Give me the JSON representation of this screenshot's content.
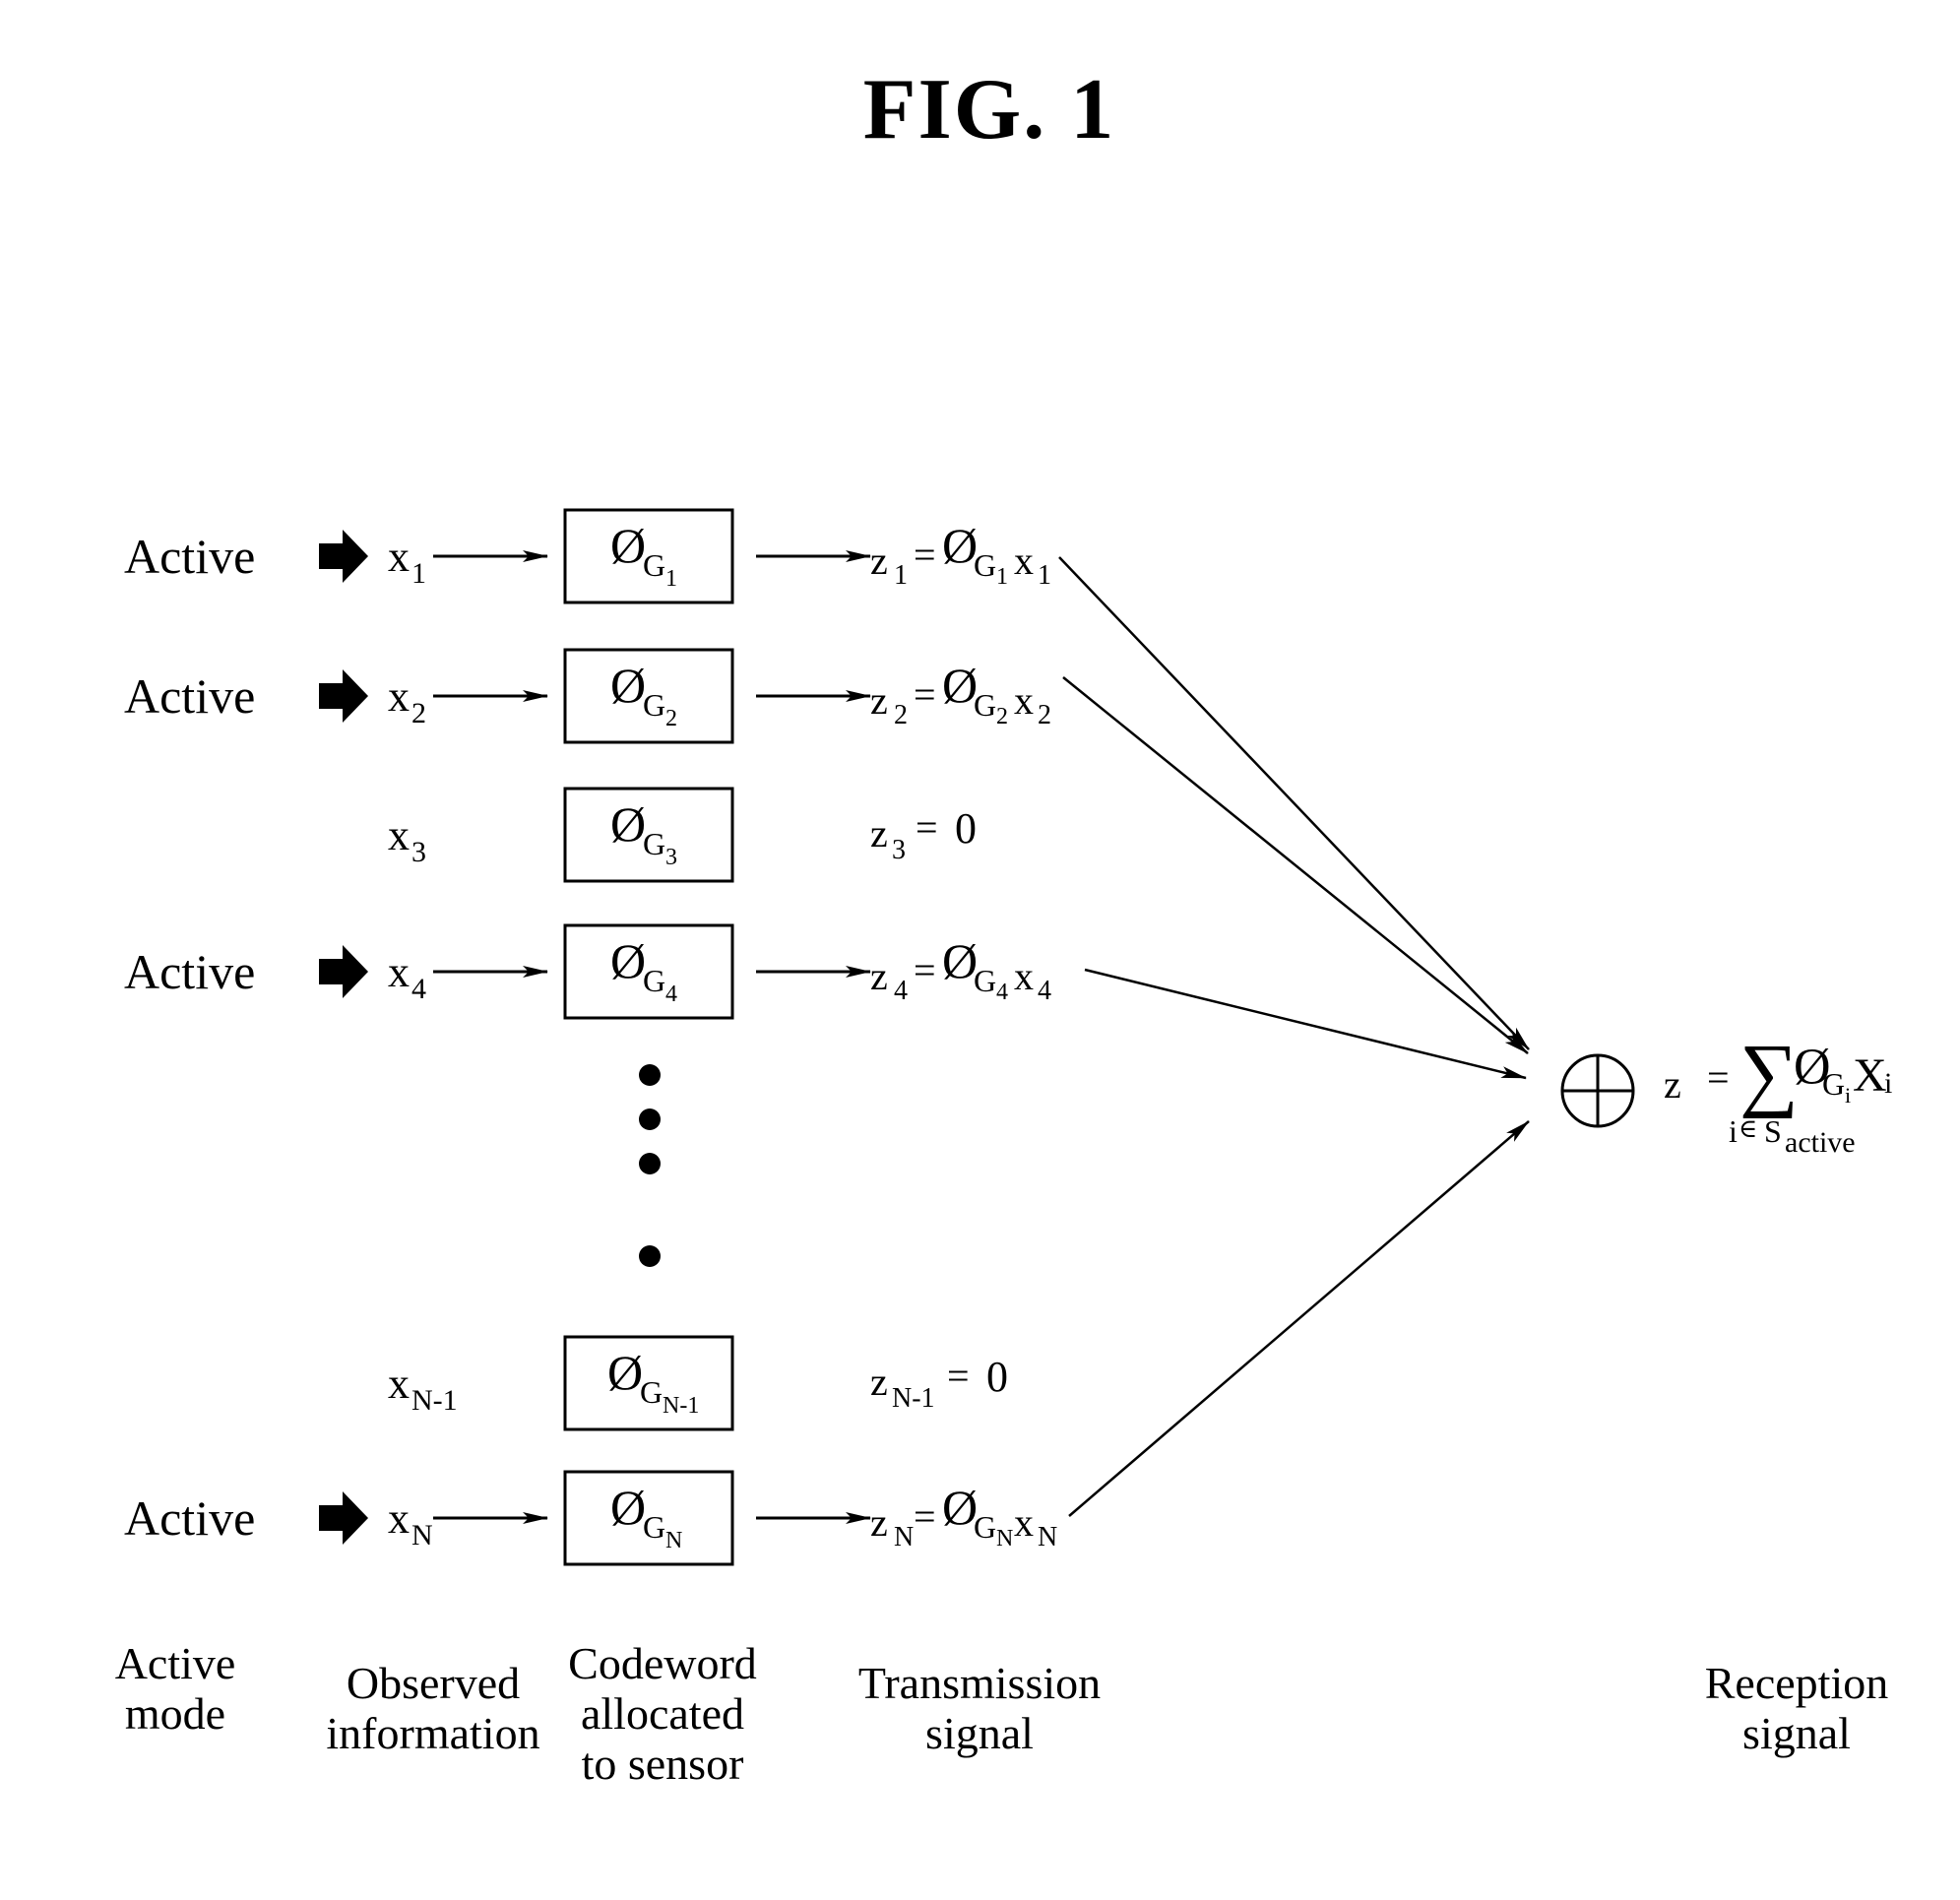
{
  "figure": {
    "title": "FIG. 1"
  },
  "rows": [
    {
      "id": "1",
      "active": true,
      "mode_label": "Active",
      "x_var": "x",
      "x_sub": "1",
      "codeword_base": "Ø",
      "codeword_sym": "G",
      "codeword_sub": "1",
      "z_var": "z",
      "z_sub": "1",
      "z_eq": "=",
      "z_phi": "Ø",
      "z_g": "G",
      "z_gsub": "1",
      "z_x": "x",
      "z_xsub": "1",
      "z_value": ""
    },
    {
      "id": "2",
      "active": true,
      "mode_label": "Active",
      "x_var": "x",
      "x_sub": "2",
      "codeword_base": "Ø",
      "codeword_sym": "G",
      "codeword_sub": "2",
      "z_var": "z",
      "z_sub": "2",
      "z_eq": "=",
      "z_phi": "Ø",
      "z_g": "G",
      "z_gsub": "2",
      "z_x": "x",
      "z_xsub": "2",
      "z_value": ""
    },
    {
      "id": "3",
      "active": false,
      "mode_label": "",
      "x_var": "x",
      "x_sub": "3",
      "codeword_base": "Ø",
      "codeword_sym": "G",
      "codeword_sub": "3",
      "z_var": "z",
      "z_sub": "3",
      "z_eq": "=",
      "z_phi": "",
      "z_g": "",
      "z_gsub": "",
      "z_x": "",
      "z_xsub": "",
      "z_value": "0"
    },
    {
      "id": "4",
      "active": true,
      "mode_label": "Active",
      "x_var": "x",
      "x_sub": "4",
      "codeword_base": "Ø",
      "codeword_sym": "G",
      "codeword_sub": "4",
      "z_var": "z",
      "z_sub": "4",
      "z_eq": "=",
      "z_phi": "Ø",
      "z_g": "G",
      "z_gsub": "4",
      "z_x": "x",
      "z_xsub": "4",
      "z_value": ""
    },
    {
      "id": "N-1",
      "active": false,
      "mode_label": "",
      "x_var": "x",
      "x_sub": "N-1",
      "codeword_base": "Ø",
      "codeword_sym": "G",
      "codeword_sub": "N-1",
      "z_var": "z",
      "z_sub": "N-1",
      "z_eq": "=",
      "z_phi": "",
      "z_g": "",
      "z_gsub": "",
      "z_x": "",
      "z_xsub": "",
      "z_value": "0"
    },
    {
      "id": "N",
      "active": true,
      "mode_label": "Active",
      "x_var": "x",
      "x_sub": "N",
      "codeword_base": "Ø",
      "codeword_sym": "G",
      "codeword_sub": "N",
      "z_var": "z",
      "z_sub": "N",
      "z_eq": "=",
      "z_phi": "Ø",
      "z_g": "G",
      "z_gsub": "N",
      "z_x": "x",
      "z_xsub": "N",
      "z_value": ""
    }
  ],
  "ellipsis": {
    "dot_count": 4
  },
  "combiner": {
    "symbol": "circled-plus",
    "formula": {
      "lhs": "z",
      "eq": "=",
      "sum": "∑",
      "phi": "Ø",
      "g": "G",
      "g_sub": "i",
      "x": "X",
      "x_sub": "i",
      "index_var": "i",
      "index_rel": "∈",
      "index_set": "S",
      "index_set_sub": "active"
    }
  },
  "column_labels": {
    "active_mode": [
      "Active",
      "mode"
    ],
    "observed_information": [
      "Observed",
      "information"
    ],
    "codeword": [
      "Codeword",
      "allocated",
      "to sensor"
    ],
    "transmission_signal": [
      "Transmission",
      "signal"
    ],
    "reception_signal": [
      "Reception",
      "signal"
    ]
  },
  "colors": {
    "ink": "#000000",
    "background": "#ffffff"
  }
}
